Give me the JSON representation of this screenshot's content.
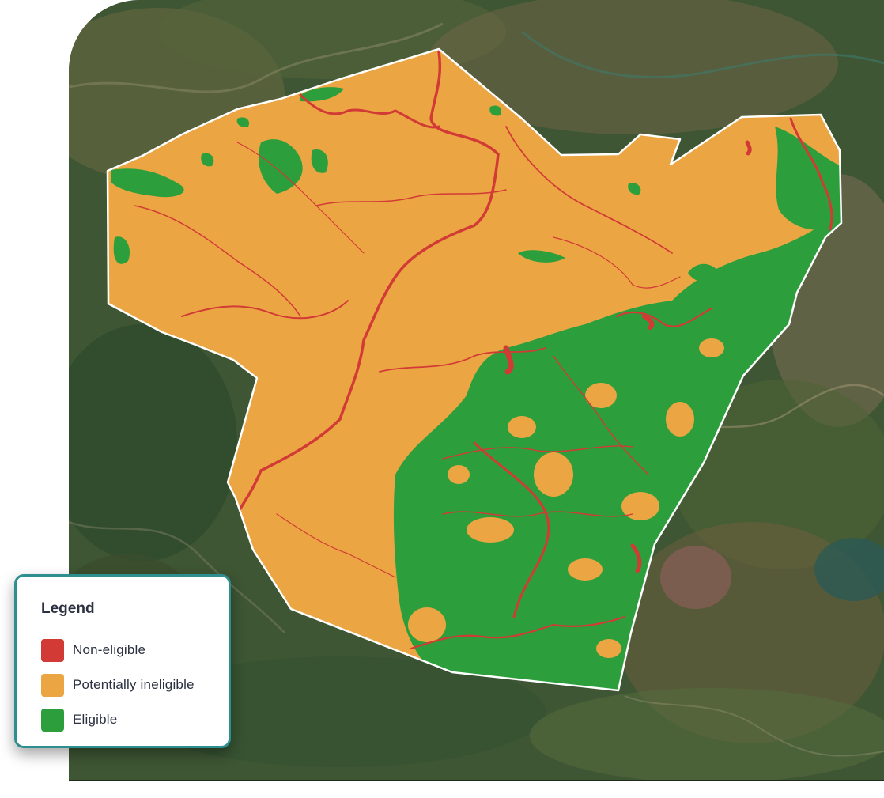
{
  "map": {
    "basemap": "satellite-imagery",
    "area_outline_color": "#ffffff",
    "class_colors": {
      "non_eligible": "#d23a36",
      "potentially_ineligible": "#eba643",
      "eligible": "#2c9f3c"
    }
  },
  "legend": {
    "title": "Legend",
    "items": [
      {
        "label": "Non-eligible",
        "color": "#d23a36"
      },
      {
        "label": "Potentially ineligible",
        "color": "#eba643"
      },
      {
        "label": "Eligible",
        "color": "#2c9f3c"
      }
    ]
  }
}
